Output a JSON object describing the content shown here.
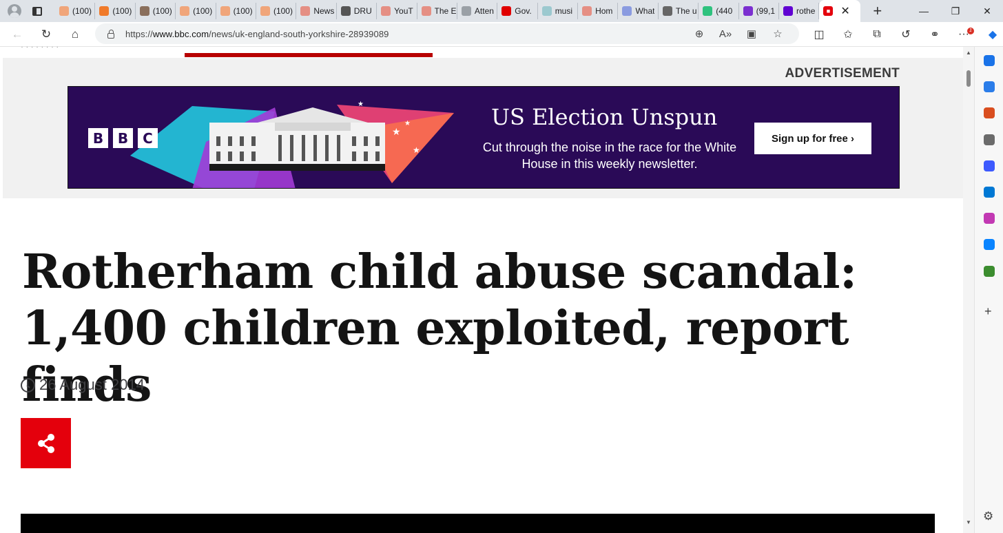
{
  "browser": {
    "tabs": [
      {
        "title": "(100)",
        "fav_color": "#f0a57a"
      },
      {
        "title": "(100)",
        "fav_color": "#f07a2a"
      },
      {
        "title": "(100)",
        "fav_color": "#8a6f5c"
      },
      {
        "title": "(100)",
        "fav_color": "#f0a57a"
      },
      {
        "title": "(100)",
        "fav_color": "#f0a57a"
      },
      {
        "title": "(100)",
        "fav_color": "#f0a57a"
      },
      {
        "title": "News",
        "fav_color": "#e58f84"
      },
      {
        "title": "DRU",
        "fav_color": "#555555"
      },
      {
        "title": "YouT",
        "fav_color": "#e58f84"
      },
      {
        "title": "The E",
        "fav_color": "#e58f84"
      },
      {
        "title": "Atten",
        "fav_color": "#9aa0a6"
      },
      {
        "title": "Gov.",
        "fav_color": "#e00000"
      },
      {
        "title": "musi",
        "fav_color": "#9cc9cf"
      },
      {
        "title": "Hom",
        "fav_color": "#e58f84"
      },
      {
        "title": "What",
        "fav_color": "#8a9be0"
      },
      {
        "title": "The u",
        "fav_color": "#666666"
      },
      {
        "title": "(440",
        "fav_color": "#2ec27e"
      },
      {
        "title": "(99,1",
        "fav_color": "#7b2fd0"
      },
      {
        "title": "rothe",
        "fav_color": "#6001d2"
      }
    ],
    "active_tab_fav_color": "#e4000c",
    "url_prefix": "https://",
    "url_host": "www.bbc.com",
    "url_path": "/news/uk-england-south-yorkshire-28939089",
    "icons": {
      "back": "←",
      "refresh": "↻",
      "home": "⌂",
      "zoom": "⊕",
      "read_aloud": "A»",
      "immersive": "▣",
      "favorite": "☆",
      "split": "◫",
      "favorites": "✩",
      "collections": "⧉",
      "history": "↺",
      "extensions": "⚭",
      "more": "···",
      "plus": "+",
      "gear": "⚙",
      "minimize": "—",
      "restore": "❐",
      "close": "✕",
      "newtab": "+",
      "scroll_up": "▲",
      "scroll_down": "▼"
    },
    "notification_count": "1"
  },
  "sidebar_colors": [
    "#1a73e8",
    "#2b7de9",
    "#d94e1f",
    "#6b6b6b",
    "#3d5afe",
    "#0078d4",
    "#c239b3",
    "#0a84ff",
    "#3c8d2f"
  ],
  "page": {
    "nav_cut_text": "· · · · · · · ·",
    "ad_label": "ADVERTISEMENT",
    "ad": {
      "logo": [
        "B",
        "B",
        "C"
      ],
      "title": "US Election Unspun",
      "subtitle": "Cut through the noise in the race for the White House in this weekly newsletter.",
      "button": "Sign up for free ›"
    },
    "headline": "Rotherham child abuse scandal: 1,400 children exploited, report finds",
    "date": "26 August 2014"
  }
}
